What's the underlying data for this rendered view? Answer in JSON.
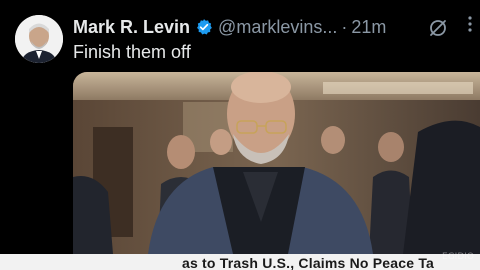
{
  "post": {
    "author_name": "Mark R. Levin",
    "handle": "@marklevins...",
    "separator": "·",
    "timestamp": "21m",
    "text": "Finish them off"
  },
  "icons": {
    "verified": "verified-badge-icon",
    "grok": "grok-icon",
    "more": "more-options-icon"
  },
  "colors": {
    "verified": "#1d9bf0",
    "muted": "#8b98a5",
    "text": "#e7e9ea"
  },
  "news_banner": {
    "text": "as to Trash U.S., Claims No Peace Ta"
  },
  "watermark": "EGIDIO"
}
